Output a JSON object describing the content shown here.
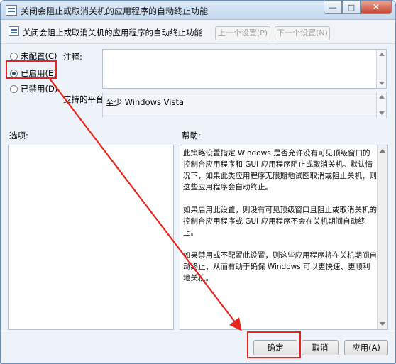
{
  "window": {
    "title": "关闭会阻止或取消关机的应用程序的自动终止功能",
    "caption_min": "—",
    "caption_max": "□",
    "caption_close": "✕"
  },
  "header": {
    "title": "关闭会阻止或取消关机的应用程序的自动终止功能",
    "prev_label": "上一个设置(P)",
    "next_label": "下一个设置(N)"
  },
  "state": {
    "options": [
      {
        "label": "未配置(C)",
        "checked": false
      },
      {
        "label": "已启用(E)",
        "checked": true
      },
      {
        "label": "已禁用(D)",
        "checked": false
      }
    ]
  },
  "notes": {
    "label": "注释:",
    "value": ""
  },
  "platform": {
    "label": "支持的平台:",
    "value": "至少 Windows Vista"
  },
  "options_panel": {
    "label": "选项:"
  },
  "help_panel": {
    "label": "帮助:",
    "paragraphs": [
      "此策略设置指定 Windows 是否允许没有可见顶级窗口的控制台应用程序和 GUI 应用程序阻止或取消关机。默认情况下，如果此类应用程序无限期地试图取消或阻止关机，则这些应用程序会自动终止。",
      "如果启用此设置，则没有可见顶级窗口且阻止或取消关机的控制台应用程序或 GUI 应用程序不会在关机期间自动终止。",
      "如果禁用或不配置此设置，则这些应用程序将在关机期间自动终止，从而有助于确保 Windows 可以更快速、更顺利地关机。"
    ]
  },
  "footer": {
    "ok_label": "确定",
    "cancel_label": "取消",
    "apply_label": "应用(A)"
  },
  "annotation": {
    "color": "#e8251c"
  }
}
